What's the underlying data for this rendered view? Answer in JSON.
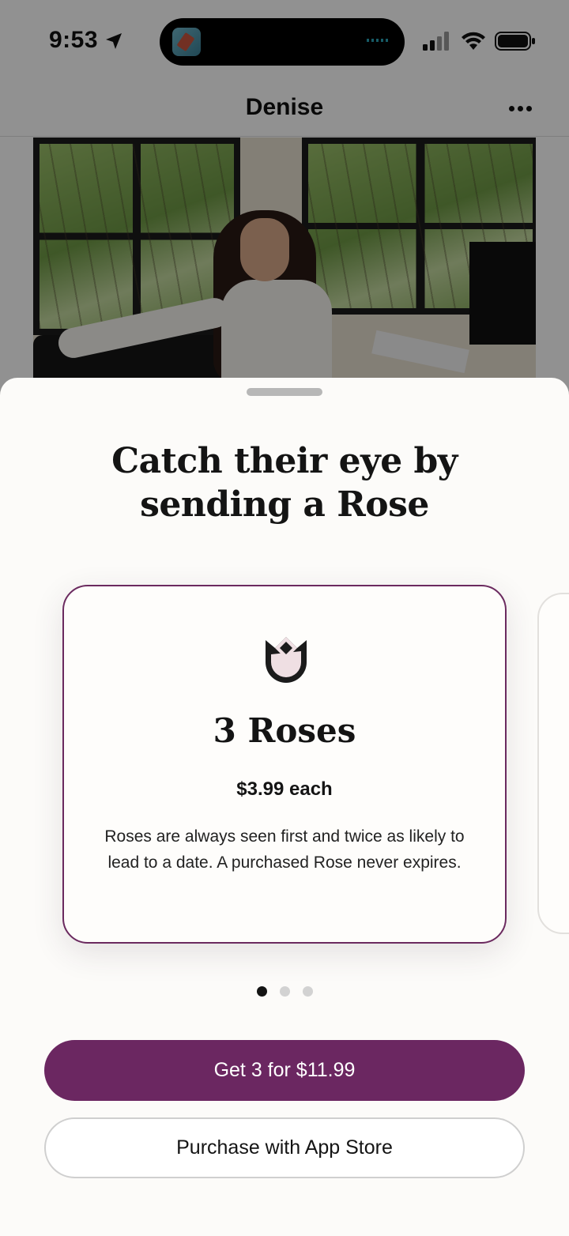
{
  "status_bar": {
    "time": "9:53"
  },
  "nav": {
    "title": "Denise"
  },
  "sheet": {
    "title": "Catch their eye by sending a Rose",
    "card": {
      "title": "3 Roses",
      "price": "$3.99 each",
      "description": "Roses are always seen first and twice as likely to lead to a date. A purchased Rose never expires."
    },
    "pager": {
      "total": 3,
      "active_index": 0
    },
    "primary_button_label": "Get 3 for $11.99",
    "secondary_button_label": "Purchase with App Store"
  },
  "colors": {
    "accent": "#6b2761",
    "card_border": "#6b2a5f"
  }
}
